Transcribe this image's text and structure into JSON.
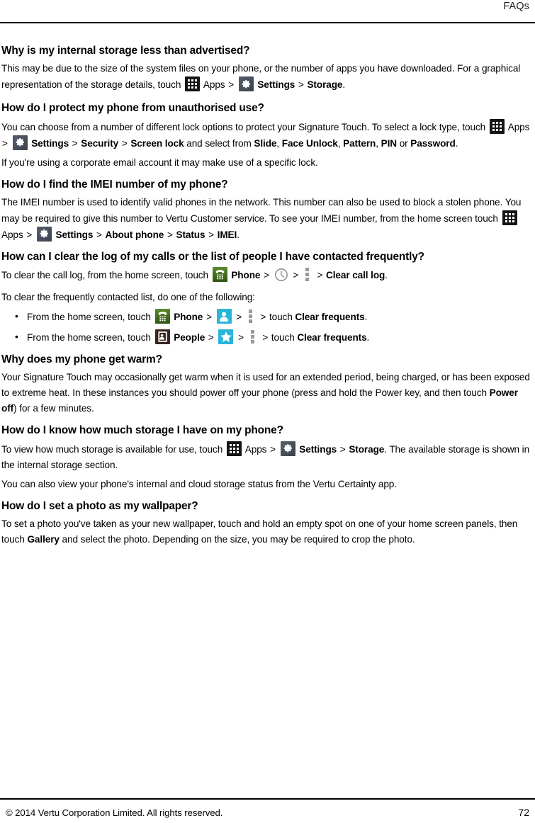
{
  "header": {
    "title": "FAQs"
  },
  "footer": {
    "copyright": "© 2014 Vertu Corporation Limited. All rights reserved.",
    "page_number": "72"
  },
  "icons": {
    "apps": "apps-grid-icon",
    "settings": "gear-icon",
    "phone": "phone-handset-icon",
    "people": "people-contact-card-icon",
    "person": "person-silhouette-icon",
    "star": "star-favorites-icon",
    "clock": "clock-icon",
    "menu": "overflow-menu-icon"
  },
  "labels": {
    "apps": "Apps",
    "settings": "Settings",
    "phone": "Phone",
    "people": "People",
    "storage": "Storage",
    "security": "Security",
    "screen_lock": "Screen lock",
    "slide": "Slide",
    "face_unlock": "Face Unlock",
    "pattern": "Pattern",
    "pin": "PIN",
    "password": "Password",
    "about_phone": "About phone",
    "status": "Status",
    "imei": "IMEI",
    "clear_call_log": "Clear call log",
    "clear_frequents": "Clear frequents",
    "power_off": "Power off",
    "gallery": "Gallery",
    "chevron": ">"
  },
  "faqs": [
    {
      "id": "internal-storage",
      "question": "Why is my internal storage less than advertised?",
      "answer_part1": "This may be due to the size of the system files on your phone, or the number of apps you have downloaded. For a graphical representation of the storage details, touch",
      "answer_part2": ".",
      "trailing": "."
    },
    {
      "id": "protect-phone",
      "question": "How do I protect my phone from unauthorised use?",
      "answer_part1": "You can choose from a number of different lock options to protect your Signature Touch. To select a lock type, touch",
      "mid1": "and select from",
      "mid2": "or",
      "trailing": ".",
      "answer_part2": "If you're using a corporate email account it may make use of a specific lock."
    },
    {
      "id": "imei-number",
      "question": "How do I find the IMEI number of my phone?",
      "answer_part1": "The IMEI number is used to identify valid phones in the network. This number can also be used to block a stolen phone. You may be required to give this number to Vertu Customer service. To see your IMEI number, from the home screen touch",
      "trailing": "."
    },
    {
      "id": "clear-call-log",
      "question": "How can I clear the log of my calls or the list of people I have contacted frequently?",
      "answer_part1": "To clear the call log, from the home screen, touch",
      "trailing": ".",
      "answer_part2": "To clear the frequently contacted list, do one of the following:",
      "bullets": [
        {
          "prefix": "From the home screen, touch",
          "mid": "touch",
          "trailing": "."
        },
        {
          "prefix": "From the home screen, touch",
          "mid": "touch",
          "trailing": "."
        }
      ]
    },
    {
      "id": "phone-warm",
      "question": "Why does my phone get warm?",
      "answer_part1": "Your Signature Touch may occasionally get warm when it is used for an extended period, being charged, or has been exposed to extreme heat. In these instances you should power off your phone (press and hold the Power key, and then touch",
      "answer_part2": ") for a few minutes."
    },
    {
      "id": "how-much-storage",
      "question": "How do I know how much storage I have on my phone?",
      "answer_part1": "To view how much storage is available for use, touch",
      "answer_part2": ". The available storage is shown in the internal storage section.",
      "answer_part3": "You can also view your phone's internal and cloud storage status from the Vertu Certainty app."
    },
    {
      "id": "set-wallpaper",
      "question": "How do I set a photo as my wallpaper?",
      "answer_part1": "To set a photo you've taken as your new wallpaper, touch and hold an empty spot on one of your home screen panels, then touch",
      "answer_part2": "and select the photo. Depending on the size, you may be required to crop the photo."
    }
  ]
}
